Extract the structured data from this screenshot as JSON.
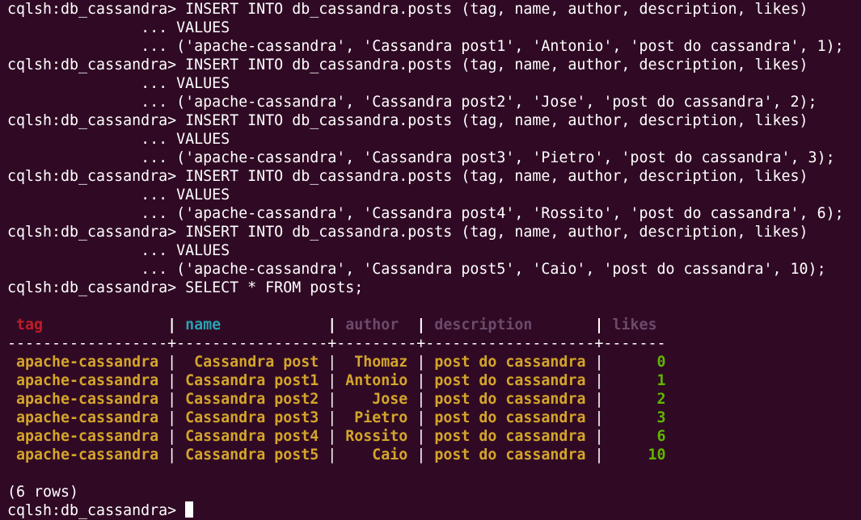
{
  "terminal": {
    "lines": [
      "cqlsh:db_cassandra> INSERT INTO db_cassandra.posts (tag, name, author, description, likes)",
      "               ... VALUES",
      "               ... ('apache-cassandra', 'Cassandra post1', 'Antonio', 'post do cassandra', 1);",
      "cqlsh:db_cassandra> INSERT INTO db_cassandra.posts (tag, name, author, description, likes)",
      "               ... VALUES",
      "               ... ('apache-cassandra', 'Cassandra post2', 'Jose', 'post do cassandra', 2);",
      "cqlsh:db_cassandra> INSERT INTO db_cassandra.posts (tag, name, author, description, likes)",
      "               ... VALUES",
      "               ... ('apache-cassandra', 'Cassandra post3', 'Pietro', 'post do cassandra', 3);",
      "cqlsh:db_cassandra> INSERT INTO db_cassandra.posts (tag, name, author, description, likes)",
      "               ... VALUES",
      "               ... ('apache-cassandra', 'Cassandra post4', 'Rossito', 'post do cassandra', 6);",
      "cqlsh:db_cassandra> INSERT INTO db_cassandra.posts (tag, name, author, description, likes)",
      "               ... VALUES",
      "               ... ('apache-cassandra', 'Cassandra post5', 'Caio', 'post do cassandra', 10);",
      "cqlsh:db_cassandra> SELECT * FROM posts;"
    ],
    "table": {
      "headers": {
        "tag": " tag              ",
        "sep1": "| ",
        "name": "name            ",
        "sep2": "| ",
        "author": "author  ",
        "sep3": "| ",
        "description": "description       ",
        "sep4": "| ",
        "likes": "likes"
      },
      "divider": "------------------+-----------------+---------+-------------------+-------",
      "rows": [
        {
          "tag": " apache-cassandra ",
          "name": "  Cassandra post ",
          "author": "  Thomaz ",
          "description": " post do cassandra ",
          "likes": "      0"
        },
        {
          "tag": " apache-cassandra ",
          "name": " Cassandra post1 ",
          "author": " Antonio ",
          "description": " post do cassandra ",
          "likes": "      1"
        },
        {
          "tag": " apache-cassandra ",
          "name": " Cassandra post2 ",
          "author": "    Jose ",
          "description": " post do cassandra ",
          "likes": "      2"
        },
        {
          "tag": " apache-cassandra ",
          "name": " Cassandra post3 ",
          "author": "  Pietro ",
          "description": " post do cassandra ",
          "likes": "      3"
        },
        {
          "tag": " apache-cassandra ",
          "name": " Cassandra post4 ",
          "author": " Rossito ",
          "description": " post do cassandra ",
          "likes": "      6"
        },
        {
          "tag": " apache-cassandra ",
          "name": " Cassandra post5 ",
          "author": "    Caio ",
          "description": " post do cassandra ",
          "likes": "     10"
        }
      ],
      "row_count_text": "(6 rows)"
    },
    "final_prompt": "cqlsh:db_cassandra> "
  },
  "colors": {
    "background": "#300a24",
    "text": "#ffffff",
    "header_tag": "#c01c28",
    "header_name": "#2aa1b3",
    "header_muted": "#6b4a6b",
    "value_text": "#d4a52b",
    "value_number": "#5fb700"
  }
}
